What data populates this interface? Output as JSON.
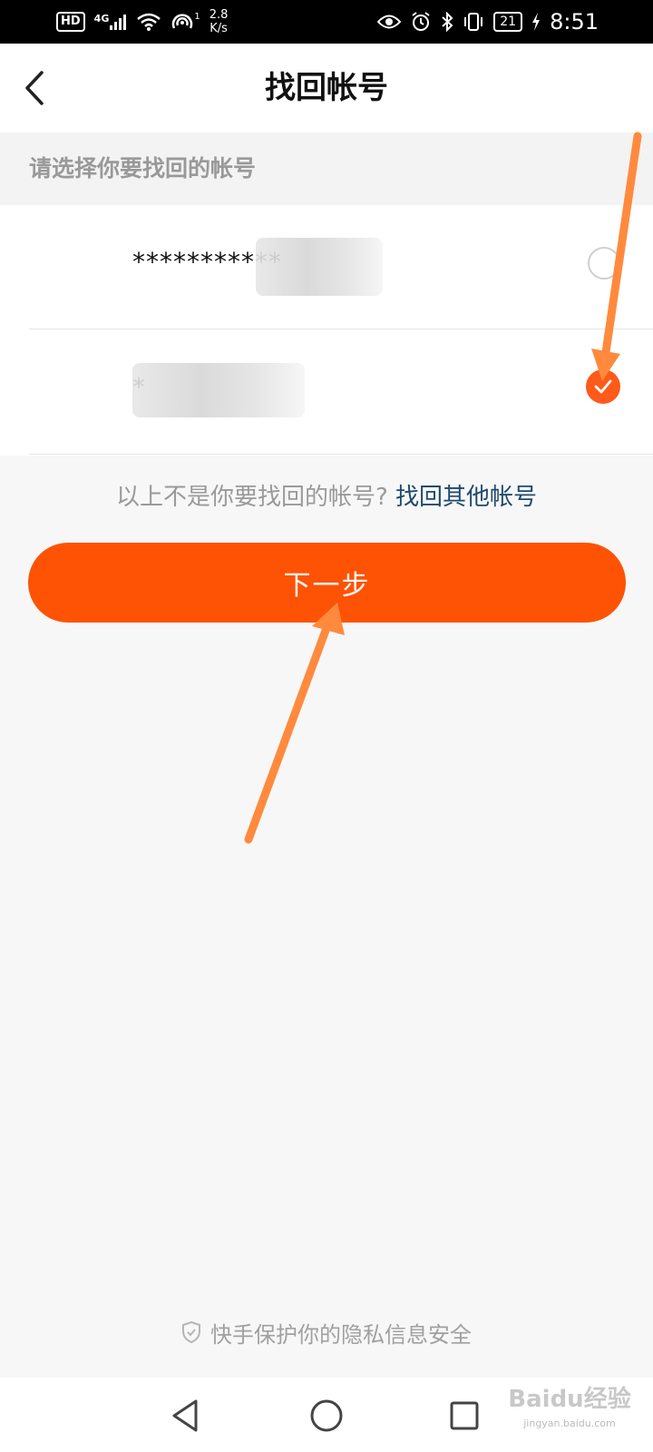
{
  "status_bar": {
    "hd": "HD",
    "network": "4G",
    "hotspot_count": "1",
    "speed_value": "2.8",
    "speed_unit": "K/s",
    "battery": "21",
    "time": "8:51"
  },
  "header": {
    "title": "找回帐号"
  },
  "section": {
    "label": "请选择你要找回的帐号"
  },
  "accounts": [
    {
      "masked": "***********",
      "selected": false
    },
    {
      "masked": "*",
      "selected": true
    }
  ],
  "other_prompt": {
    "question": "以上不是你要找回的帐号?",
    "link": "找回其他帐号"
  },
  "next_button": {
    "label": "下一步"
  },
  "privacy": {
    "text": "快手保护你的隐私信息安全"
  },
  "watermark": {
    "text": "Baidu经验",
    "url": "jingyan.baidu.com"
  },
  "colors": {
    "accent": "#fe5304",
    "check": "#fe5a1a",
    "link": "#1e4a6e",
    "annotation_arrow": "#ff8a3d"
  }
}
